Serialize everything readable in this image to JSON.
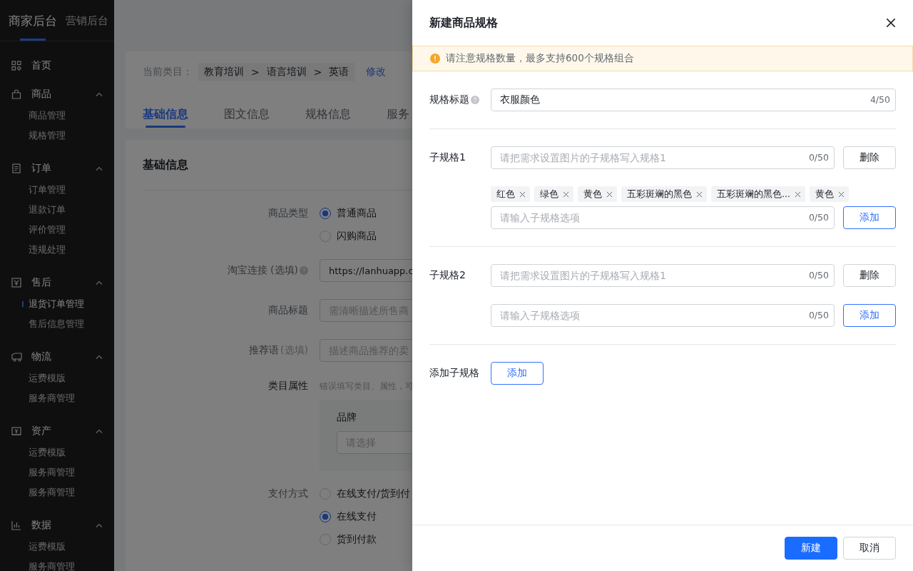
{
  "sidebar": {
    "header_tabs": [
      {
        "label": "商家后台",
        "selected": true
      },
      {
        "label": "营销后台",
        "selected": false
      }
    ],
    "groups": [
      {
        "label": "首页"
      },
      {
        "label": "商品",
        "expanded": true,
        "children": [
          {
            "label": "商品管理",
            "selected": false
          },
          {
            "label": "规格管理",
            "selected": false
          }
        ]
      },
      {
        "label": "订单",
        "expanded": true,
        "children": [
          {
            "label": "订单管理",
            "selected": false
          },
          {
            "label": "退款订单",
            "selected": false
          },
          {
            "label": "评价管理",
            "selected": false
          },
          {
            "label": "违规处理",
            "selected": false
          }
        ]
      },
      {
        "label": "售后",
        "expanded": true,
        "children": [
          {
            "label": "退货订单管理",
            "selected": true
          },
          {
            "label": "售后信息管理",
            "selected": false
          }
        ]
      },
      {
        "label": "物流",
        "expanded": true,
        "children": [
          {
            "label": "运费模版",
            "selected": false
          },
          {
            "label": "服务商管理",
            "selected": false
          }
        ]
      },
      {
        "label": "资产",
        "expanded": true,
        "children": [
          {
            "label": "运费模版",
            "selected": false
          },
          {
            "label": "服务商管理",
            "selected": false
          },
          {
            "label": "服务商管理",
            "selected": false
          }
        ]
      },
      {
        "label": "数据",
        "expanded": true,
        "children": [
          {
            "label": "运费模版",
            "selected": false
          },
          {
            "label": "服务商管理",
            "selected": false
          }
        ]
      }
    ]
  },
  "main": {
    "category": {
      "label": "当前类目：",
      "path": [
        "教育培训",
        "语言培训",
        "英语"
      ],
      "separator": ">",
      "edit": "修改"
    },
    "tabs": [
      {
        "label": "基础信息",
        "selected": true
      },
      {
        "label": "图文信息",
        "selected": false
      },
      {
        "label": "规格信息",
        "selected": false
      },
      {
        "label": "服务",
        "selected": false
      }
    ],
    "card_title": "基础信息",
    "rows": [
      {
        "kind": "radio",
        "label": "商品类型",
        "options": [
          {
            "label": "普通商品",
            "selected": true
          },
          {
            "label": "闪购商品",
            "selected": false
          }
        ]
      },
      {
        "kind": "input",
        "label": "淘宝连接 (选填)",
        "help_icon": true,
        "value": "https://lanhuapp.c"
      },
      {
        "kind": "input",
        "label": "商品标题",
        "placeholder": "需清晰描述所售商"
      },
      {
        "kind": "input",
        "label": "推荐语",
        "note": "(选填)",
        "placeholder": "描述商品推荐的卖"
      },
      {
        "kind": "attributes",
        "label": "类目属性",
        "hint": "错误填写类目、属性，可",
        "field_label": "品牌",
        "field_placeholder": "请选择"
      },
      {
        "kind": "radio",
        "label": "支付方式",
        "options": [
          {
            "label": "在线支付/货到付",
            "selected": false
          },
          {
            "label": "在线支付",
            "selected": true
          },
          {
            "label": "货到付款",
            "selected": false
          }
        ]
      }
    ]
  },
  "drawer": {
    "title": "新建商品规格",
    "alert": "请注意规格数量，最多支持600个规格组合",
    "title_field": {
      "label": "规格标题",
      "value": "衣服颜色",
      "counter": "4/50"
    },
    "sub_specs": [
      {
        "label": "子规格1",
        "name_placeholder": "请把需求设置图片的子规格写入规格1",
        "name_counter": "0/50",
        "delete_label": "删除",
        "tags": [
          "红色",
          "绿色",
          "黄色",
          "五彩斑斓的黑色",
          "五彩斑斓的黑色...",
          "黄色"
        ],
        "option_placeholder": "请输入子规格选项",
        "option_counter": "0/50",
        "add_label": "添加"
      },
      {
        "label": "子规格2",
        "name_placeholder": "请把需求设置图片的子规格写入规格1",
        "name_counter": "0/50",
        "delete_label": "删除",
        "option_placeholder": "请输入子规格选项",
        "option_counter": "0/50",
        "add_label": "添加"
      }
    ],
    "add_sub_spec": {
      "label": "添加子规格",
      "button": "添加"
    },
    "footer_buttons": [
      {
        "label": "新建",
        "kind": "primary"
      },
      {
        "label": "取消",
        "kind": "default"
      }
    ]
  }
}
